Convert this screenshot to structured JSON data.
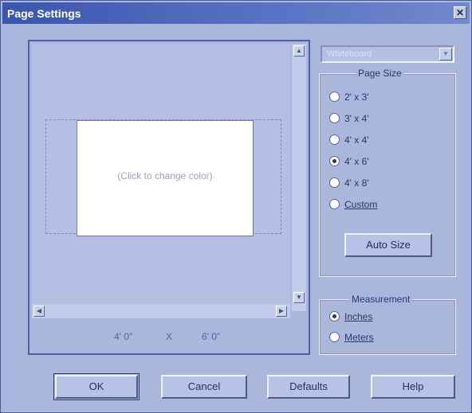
{
  "window": {
    "title": "Page Settings",
    "close_label": "✕"
  },
  "preview": {
    "page_label": "(Click to change color)",
    "width_text": "4' 0\"",
    "x_text": "X",
    "height_text": "6' 0\""
  },
  "board_type": {
    "value": "Whiteboard"
  },
  "page_size": {
    "title": "Page Size",
    "options": [
      {
        "label": "2' x 3'",
        "selected": false
      },
      {
        "label": "3' x 4'",
        "selected": false
      },
      {
        "label": "4' x 4'",
        "selected": false
      },
      {
        "label": "4' x 6'",
        "selected": true
      },
      {
        "label": "4' x 8'",
        "selected": false
      },
      {
        "label": "Custom",
        "selected": false
      }
    ],
    "auto_size_label": "Auto Size"
  },
  "measurement": {
    "title": "Measurement",
    "options": [
      {
        "label": "Inches",
        "selected": true
      },
      {
        "label": "Meters",
        "selected": false
      }
    ]
  },
  "buttons": {
    "ok": "OK",
    "cancel": "Cancel",
    "defaults": "Defaults",
    "help": "Help"
  },
  "colors": {
    "title_bar": "#3c55ad",
    "dialog_bg": "#aab6dc",
    "page_bg": "#ffffff"
  }
}
